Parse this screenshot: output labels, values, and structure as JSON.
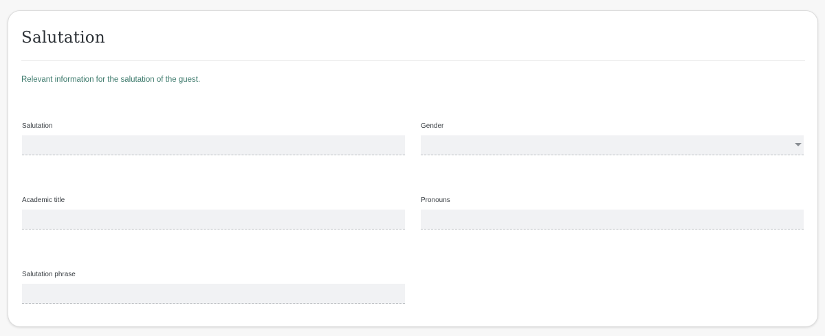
{
  "section": {
    "title": "Salutation",
    "description": "Relevant information for the salutation of the guest."
  },
  "fields": {
    "salutation": {
      "label": "Salutation",
      "value": ""
    },
    "gender": {
      "label": "Gender",
      "value": "",
      "icon": "chevron-down-icon"
    },
    "academic_title": {
      "label": "Academic title",
      "value": ""
    },
    "pronouns": {
      "label": "Pronouns",
      "value": ""
    },
    "salutation_phrase": {
      "label": "Salutation phrase",
      "value": ""
    }
  },
  "colors": {
    "description_text": "#3d7a6c",
    "input_background": "#f1f2f4"
  }
}
